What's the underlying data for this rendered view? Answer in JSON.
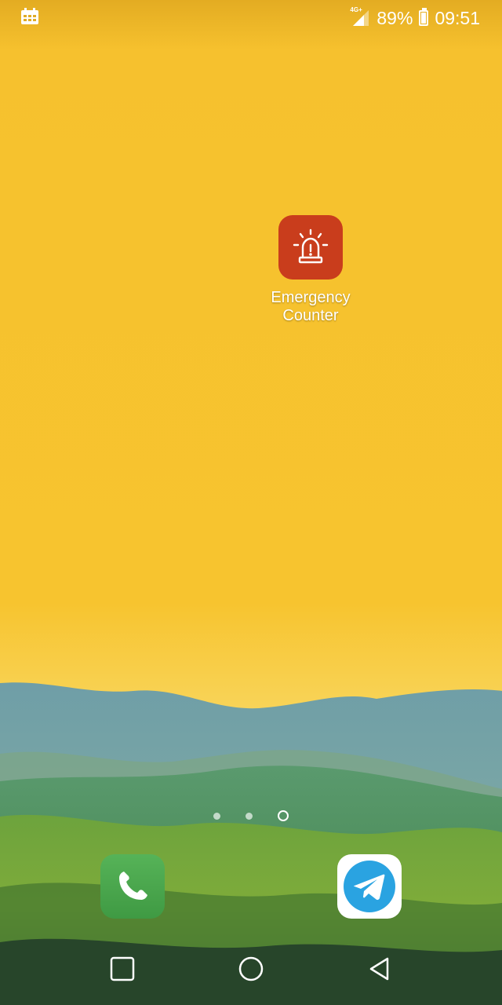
{
  "status_bar": {
    "network": "4G+",
    "battery": "89%",
    "time": "09:51"
  },
  "home_screen": {
    "apps": [
      {
        "label_line1": "Emergency",
        "label_line2": "Counter",
        "icon": "siren-icon",
        "color": "#c93d1c"
      }
    ],
    "page_indicator": {
      "pages": 3,
      "current": 3
    }
  },
  "dock": [
    {
      "app": "Phone",
      "icon": "phone-icon",
      "color": "#4caf50"
    },
    {
      "app": "Telegram",
      "icon": "telegram-icon",
      "color": "#2aa3e1"
    }
  ],
  "nav_bar": {
    "buttons": [
      "recents-icon",
      "home-icon",
      "back-icon"
    ]
  },
  "theme": {
    "wallpaper_top": "#f6c12e",
    "hills": "#5a8f3a"
  }
}
